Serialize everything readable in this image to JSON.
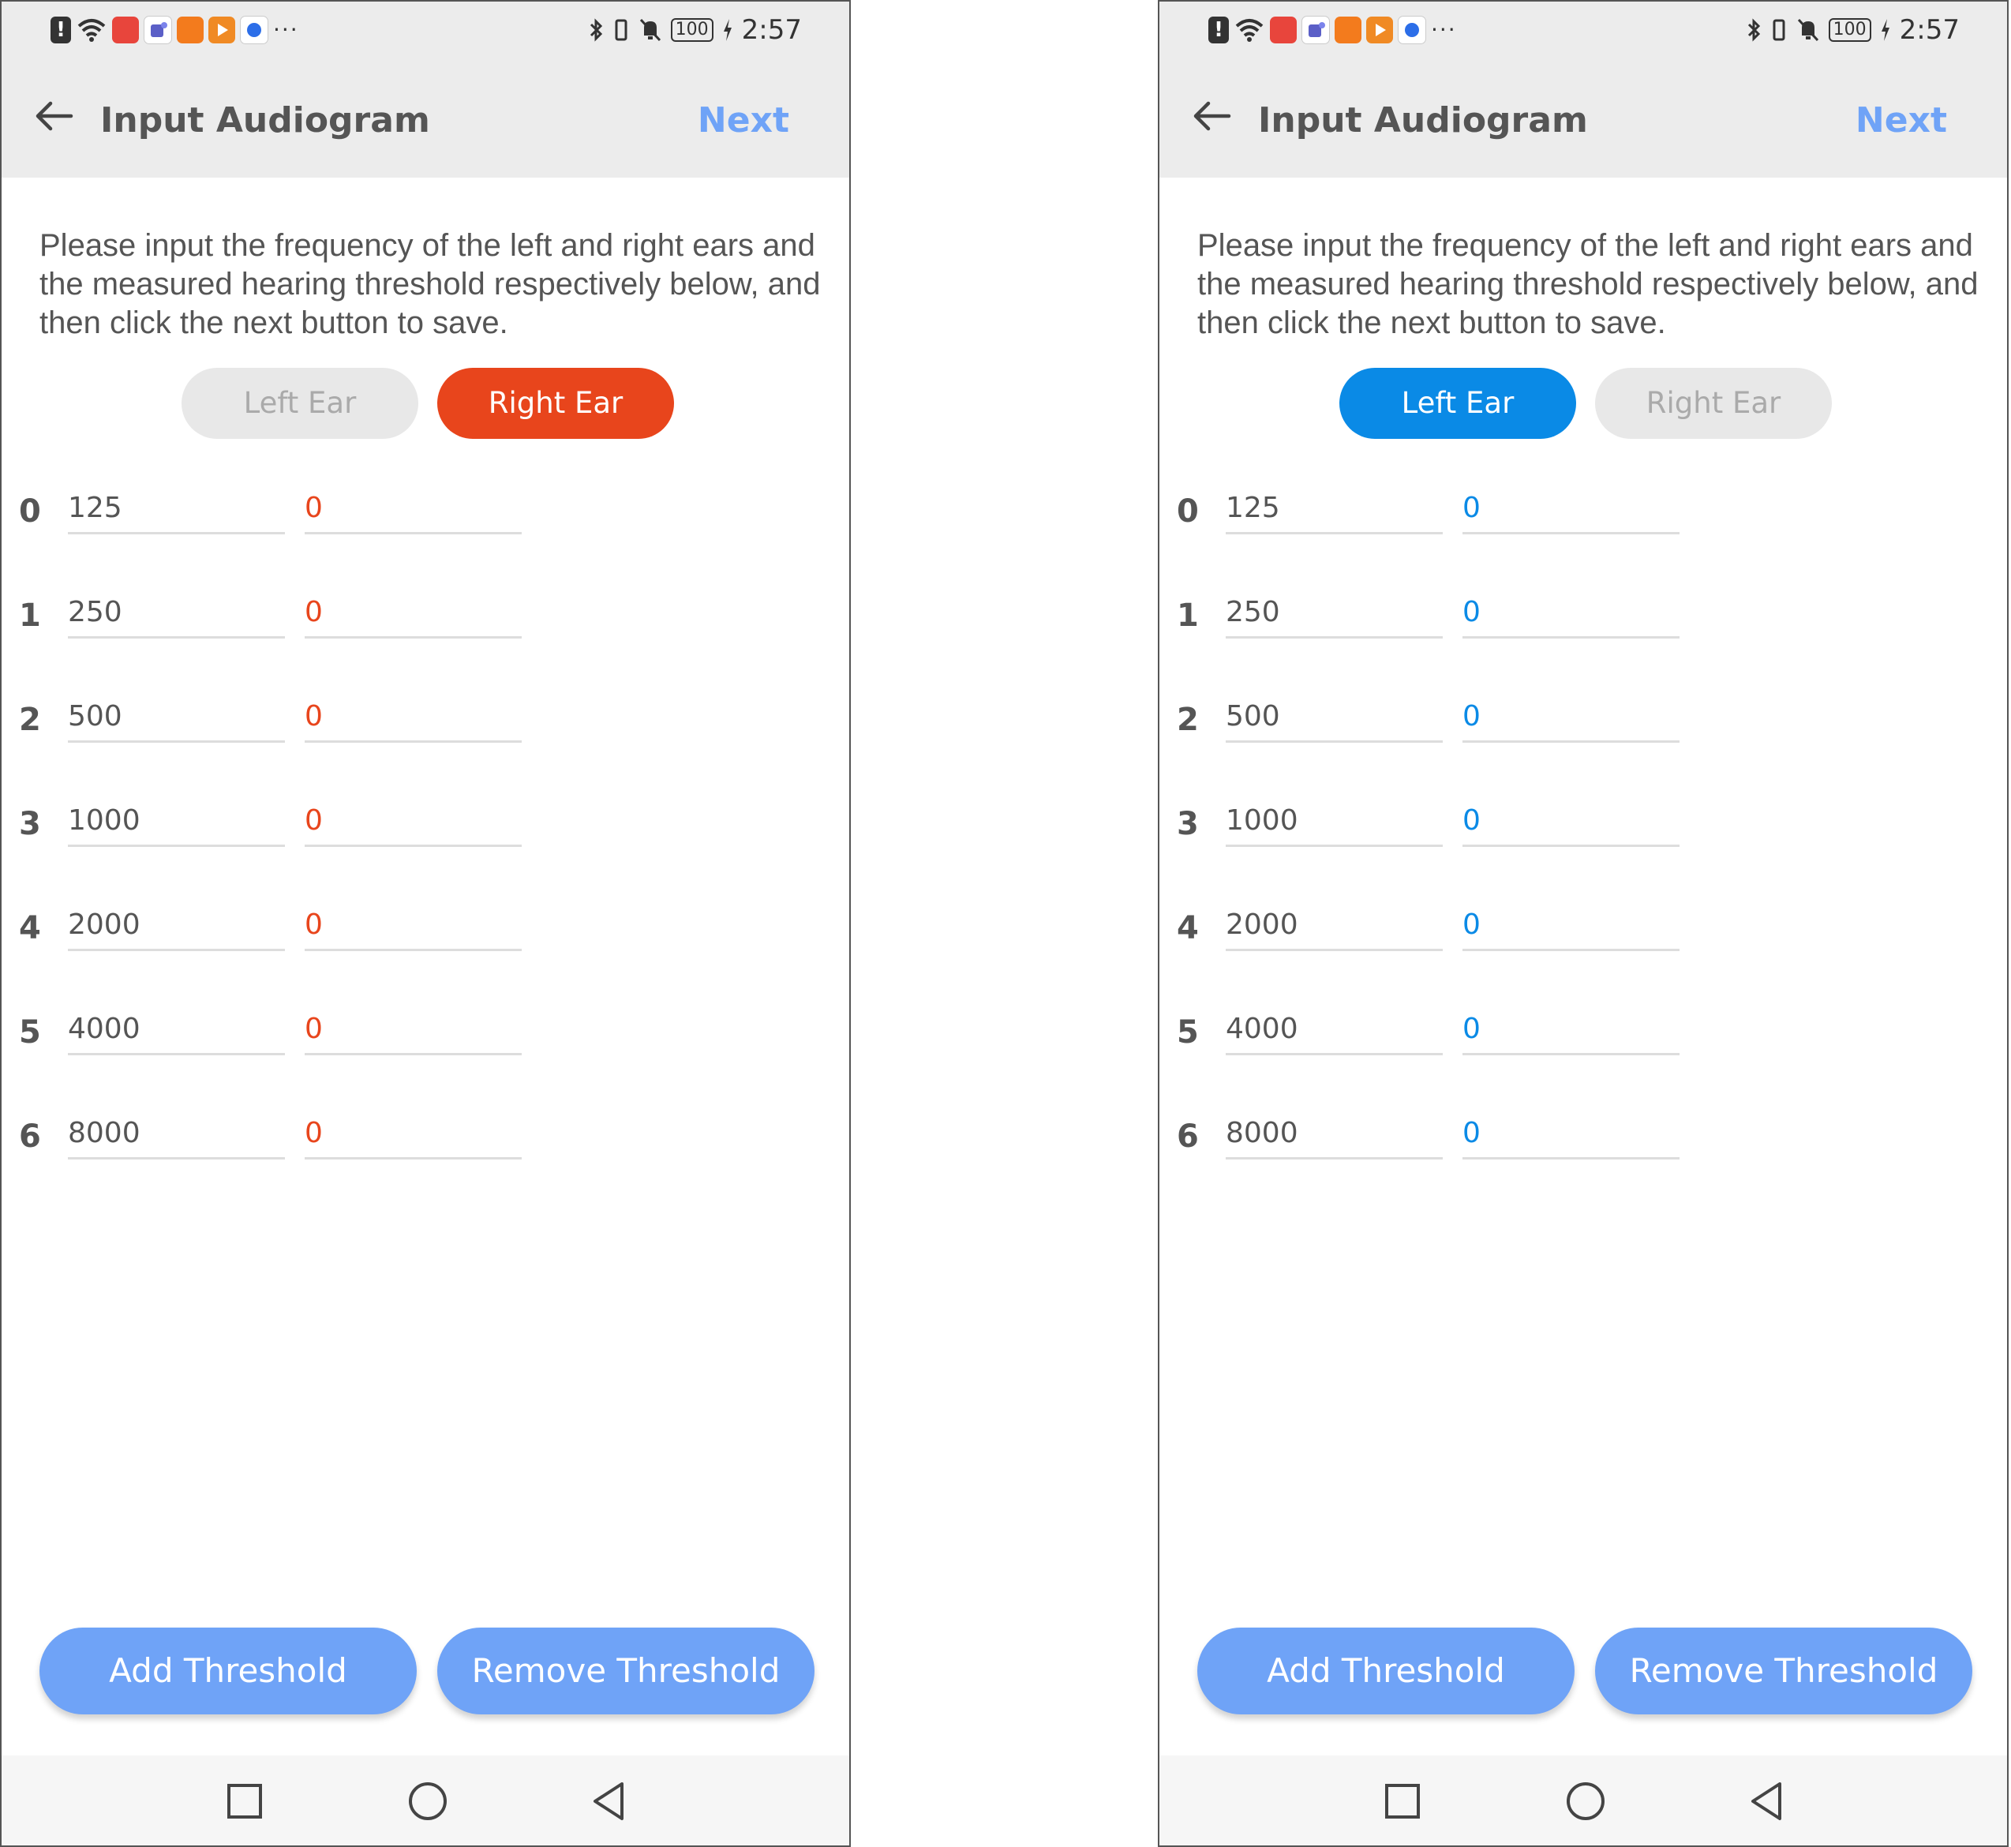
{
  "status": {
    "time": "2:57",
    "battery": "100",
    "overflow": "···",
    "icons_left": [
      "alert-icon",
      "wifi-icon",
      "huawei-app-icon",
      "teams-app-icon",
      "home-app-icon",
      "video-app-icon",
      "baidu-app-icon"
    ],
    "icons_right": [
      "bluetooth-icon",
      "vibrate-icon",
      "mute-icon",
      "battery-icon",
      "charging-icon"
    ],
    "app_colors": {
      "huawei": "#e8453c",
      "teams": "#5b5fc7",
      "home": "#f37b1d",
      "video": "#f08a24",
      "baidu": "#2c6ee8"
    }
  },
  "appbar": {
    "back_icon": "arrow-left-icon",
    "title": "Input Audiogram",
    "next_label": "Next"
  },
  "instructions": "Please input the frequency of the left and right ears and the measured hearing threshold respectively below, and then click the next button to save.",
  "segment": {
    "left_ear": "Left Ear",
    "right_ear": "Right Ear"
  },
  "colors": {
    "right_ear_accent": "#e8451c",
    "left_ear_accent": "#0a8ae6",
    "action_button": "#6fa3f7",
    "next": "#6fa3f7"
  },
  "screens": [
    {
      "selected_ear": "Right Ear",
      "rows": [
        {
          "index": "0",
          "frequency": "125",
          "threshold": "0"
        },
        {
          "index": "1",
          "frequency": "250",
          "threshold": "0"
        },
        {
          "index": "2",
          "frequency": "500",
          "threshold": "0"
        },
        {
          "index": "3",
          "frequency": "1000",
          "threshold": "0"
        },
        {
          "index": "4",
          "frequency": "2000",
          "threshold": "0"
        },
        {
          "index": "5",
          "frequency": "4000",
          "threshold": "0"
        },
        {
          "index": "6",
          "frequency": "8000",
          "threshold": "0"
        }
      ]
    },
    {
      "selected_ear": "Left Ear",
      "rows": [
        {
          "index": "0",
          "frequency": "125",
          "threshold": "0"
        },
        {
          "index": "1",
          "frequency": "250",
          "threshold": "0"
        },
        {
          "index": "2",
          "frequency": "500",
          "threshold": "0"
        },
        {
          "index": "3",
          "frequency": "1000",
          "threshold": "0"
        },
        {
          "index": "4",
          "frequency": "2000",
          "threshold": "0"
        },
        {
          "index": "5",
          "frequency": "4000",
          "threshold": "0"
        },
        {
          "index": "6",
          "frequency": "8000",
          "threshold": "0"
        }
      ]
    }
  ],
  "actions": {
    "add_label": "Add Threshold",
    "remove_label": "Remove Threshold"
  },
  "navbar": {
    "icons": [
      "recent-apps-square-icon",
      "home-circle-icon",
      "back-triangle-icon"
    ]
  }
}
